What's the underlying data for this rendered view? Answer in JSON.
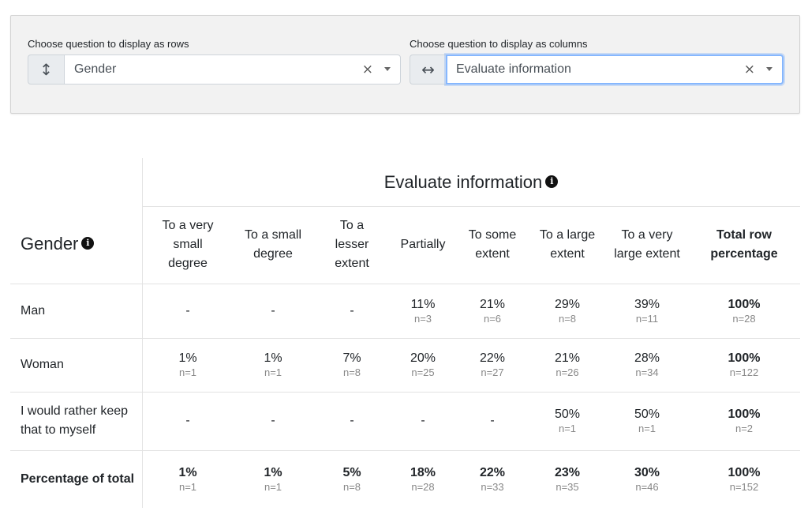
{
  "controls": {
    "rows_label": "Choose question to display as rows",
    "rows_icon": "vertical-arrows-icon",
    "rows_value": "Gender",
    "cols_label": "Choose question to display as columns",
    "cols_icon": "horizontal-arrows-icon",
    "cols_value": "Evaluate information",
    "clear_glyph": "×"
  },
  "table": {
    "col_title": "Evaluate information",
    "row_title": "Gender",
    "info_glyph": "i",
    "columns": [
      "To a very small degree",
      "To a small degree",
      "To a lesser extent",
      "Partially",
      "To some extent",
      "To a large extent",
      "To a very large extent",
      "Total row percentage"
    ],
    "rows": [
      {
        "label": "Man",
        "cells": [
          {
            "pct": "-",
            "n": ""
          },
          {
            "pct": "-",
            "n": ""
          },
          {
            "pct": "-",
            "n": ""
          },
          {
            "pct": "11%",
            "n": "n=3"
          },
          {
            "pct": "21%",
            "n": "n=6"
          },
          {
            "pct": "29%",
            "n": "n=8"
          },
          {
            "pct": "39%",
            "n": "n=11"
          },
          {
            "pct": "100%",
            "n": "n=28"
          }
        ]
      },
      {
        "label": "Woman",
        "cells": [
          {
            "pct": "1%",
            "n": "n=1"
          },
          {
            "pct": "1%",
            "n": "n=1"
          },
          {
            "pct": "7%",
            "n": "n=8"
          },
          {
            "pct": "20%",
            "n": "n=25"
          },
          {
            "pct": "22%",
            "n": "n=27"
          },
          {
            "pct": "21%",
            "n": "n=26"
          },
          {
            "pct": "28%",
            "n": "n=34"
          },
          {
            "pct": "100%",
            "n": "n=122"
          }
        ]
      },
      {
        "label": "I would rather keep that to myself",
        "cells": [
          {
            "pct": "-",
            "n": ""
          },
          {
            "pct": "-",
            "n": ""
          },
          {
            "pct": "-",
            "n": ""
          },
          {
            "pct": "-",
            "n": ""
          },
          {
            "pct": "-",
            "n": ""
          },
          {
            "pct": "50%",
            "n": "n=1"
          },
          {
            "pct": "50%",
            "n": "n=1"
          },
          {
            "pct": "100%",
            "n": "n=2"
          }
        ]
      },
      {
        "label": "Percentage of total",
        "bold": true,
        "cells": [
          {
            "pct": "1%",
            "n": "n=1"
          },
          {
            "pct": "1%",
            "n": "n=1"
          },
          {
            "pct": "5%",
            "n": "n=8"
          },
          {
            "pct": "18%",
            "n": "n=28"
          },
          {
            "pct": "22%",
            "n": "n=33"
          },
          {
            "pct": "23%",
            "n": "n=35"
          },
          {
            "pct": "30%",
            "n": "n=46"
          },
          {
            "pct": "100%",
            "n": "n=152"
          }
        ]
      }
    ]
  }
}
